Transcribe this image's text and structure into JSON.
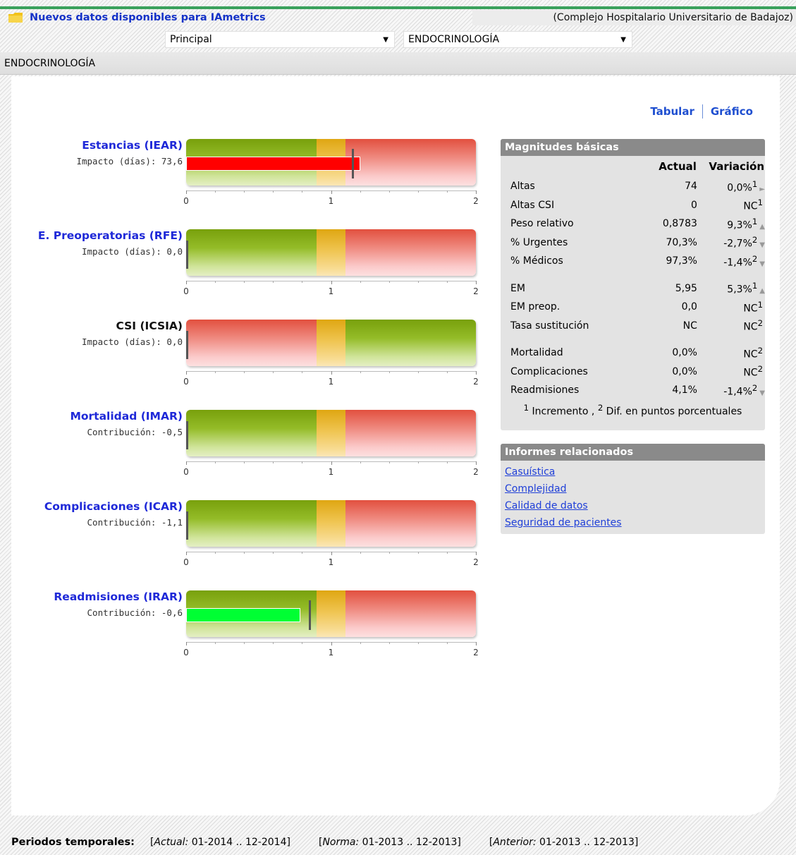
{
  "header": {
    "notice_link": "Nuevos datos disponibles para IAmetrics",
    "hospital": "(Complejo Hospitalario Universitario de Badajoz)",
    "view_select": "Principal",
    "service_select": "ENDOCRINOLOGÍA"
  },
  "breadcrumb": "ENDOCRINOLOGÍA",
  "view_toggle": {
    "tabular": "Tabular",
    "grafico": "Gráfico"
  },
  "colors": {
    "link": "#1f29d8",
    "good": "#7aa410",
    "neutral": "#e0a818",
    "bad": "#e4584a",
    "value_red": "#ff0000",
    "value_green": "#00ff33"
  },
  "chart_data": {
    "type": "bar",
    "xlim": [
      0,
      2
    ],
    "ticks": [
      "0",
      "1",
      "2"
    ],
    "neutral_band": [
      0.9,
      1.1
    ],
    "indicators": [
      {
        "title": "Estancias (IEAR)",
        "subtitle": "Impacto (días): 73,6",
        "value": 1.2,
        "reference": 1.15,
        "orientation": "lower-better",
        "title_color": "link"
      },
      {
        "title": "E. Preoperatorias (RFE)",
        "subtitle": "Impacto (días): 0,0",
        "value": 0,
        "reference": 0,
        "orientation": "lower-better",
        "title_color": "link"
      },
      {
        "title": "CSI (ICSIA)",
        "subtitle": "Impacto (días): 0,0",
        "value": 0,
        "reference": 0,
        "orientation": "higher-better",
        "title_color": "black"
      },
      {
        "title": "Mortalidad (IMAR)",
        "subtitle": "Contribución: -0,5",
        "value": 0,
        "reference": 0,
        "orientation": "lower-better",
        "title_color": "link"
      },
      {
        "title": "Complicaciones (ICAR)",
        "subtitle": "Contribución: -1,1",
        "value": 0,
        "reference": 0,
        "orientation": "lower-better",
        "title_color": "link"
      },
      {
        "title": "Readmisiones (IRAR)",
        "subtitle": "Contribución: -0,6",
        "value": 0.79,
        "reference": 0.85,
        "orientation": "lower-better",
        "title_color": "link"
      }
    ]
  },
  "magnitudes": {
    "title": "Magnitudes básicas",
    "col_actual": "Actual",
    "col_variacion": "Variación",
    "groups": [
      [
        {
          "name": "Altas",
          "actual": "74",
          "var": "0,0%",
          "sup": "1",
          "trend": "►"
        },
        {
          "name": "Altas CSI",
          "actual": "0",
          "var": "NC",
          "sup": "1",
          "trend": ""
        },
        {
          "name": "Peso relativo",
          "actual": "0,8783",
          "var": "9,3%",
          "sup": "1",
          "trend": "▲"
        },
        {
          "name": "% Urgentes",
          "actual": "70,3%",
          "var": "-2,7%",
          "sup": "2",
          "trend": "▼"
        },
        {
          "name": "% Médicos",
          "actual": "97,3%",
          "var": "-1,4%",
          "sup": "2",
          "trend": "▼"
        }
      ],
      [
        {
          "name": "EM",
          "actual": "5,95",
          "var": "5,3%",
          "sup": "1",
          "trend": "▲"
        },
        {
          "name": "EM preop.",
          "actual": "0,0",
          "var": "NC",
          "sup": "1",
          "trend": ""
        },
        {
          "name": "Tasa sustitución",
          "actual": "NC",
          "var": "NC",
          "sup": "2",
          "trend": ""
        }
      ],
      [
        {
          "name": "Mortalidad",
          "actual": "0,0%",
          "var": "NC",
          "sup": "2",
          "trend": ""
        },
        {
          "name": "Complicaciones",
          "actual": "0,0%",
          "var": "NC",
          "sup": "2",
          "trend": ""
        },
        {
          "name": "Readmisiones",
          "actual": "4,1%",
          "var": "-1,4%",
          "sup": "2",
          "trend": "▼"
        }
      ]
    ],
    "footnote_sup1": "1",
    "footnote_text1": " Incremento , ",
    "footnote_sup2": "2",
    "footnote_text2": " Dif. en puntos porcentuales"
  },
  "related": {
    "title": "Informes relacionados",
    "links": [
      "Casuística",
      "Complejidad",
      "Calidad de datos",
      "Seguridad de pacientes"
    ]
  },
  "periods": {
    "label": "Periodos temporales:",
    "items": [
      {
        "key": "Actual:",
        "range": " 01-2014 .. 12-2014"
      },
      {
        "key": "Norma:",
        "range": " 01-2013 .. 12-2013"
      },
      {
        "key": "Anterior:",
        "range": " 01-2013 .. 12-2013"
      }
    ]
  }
}
